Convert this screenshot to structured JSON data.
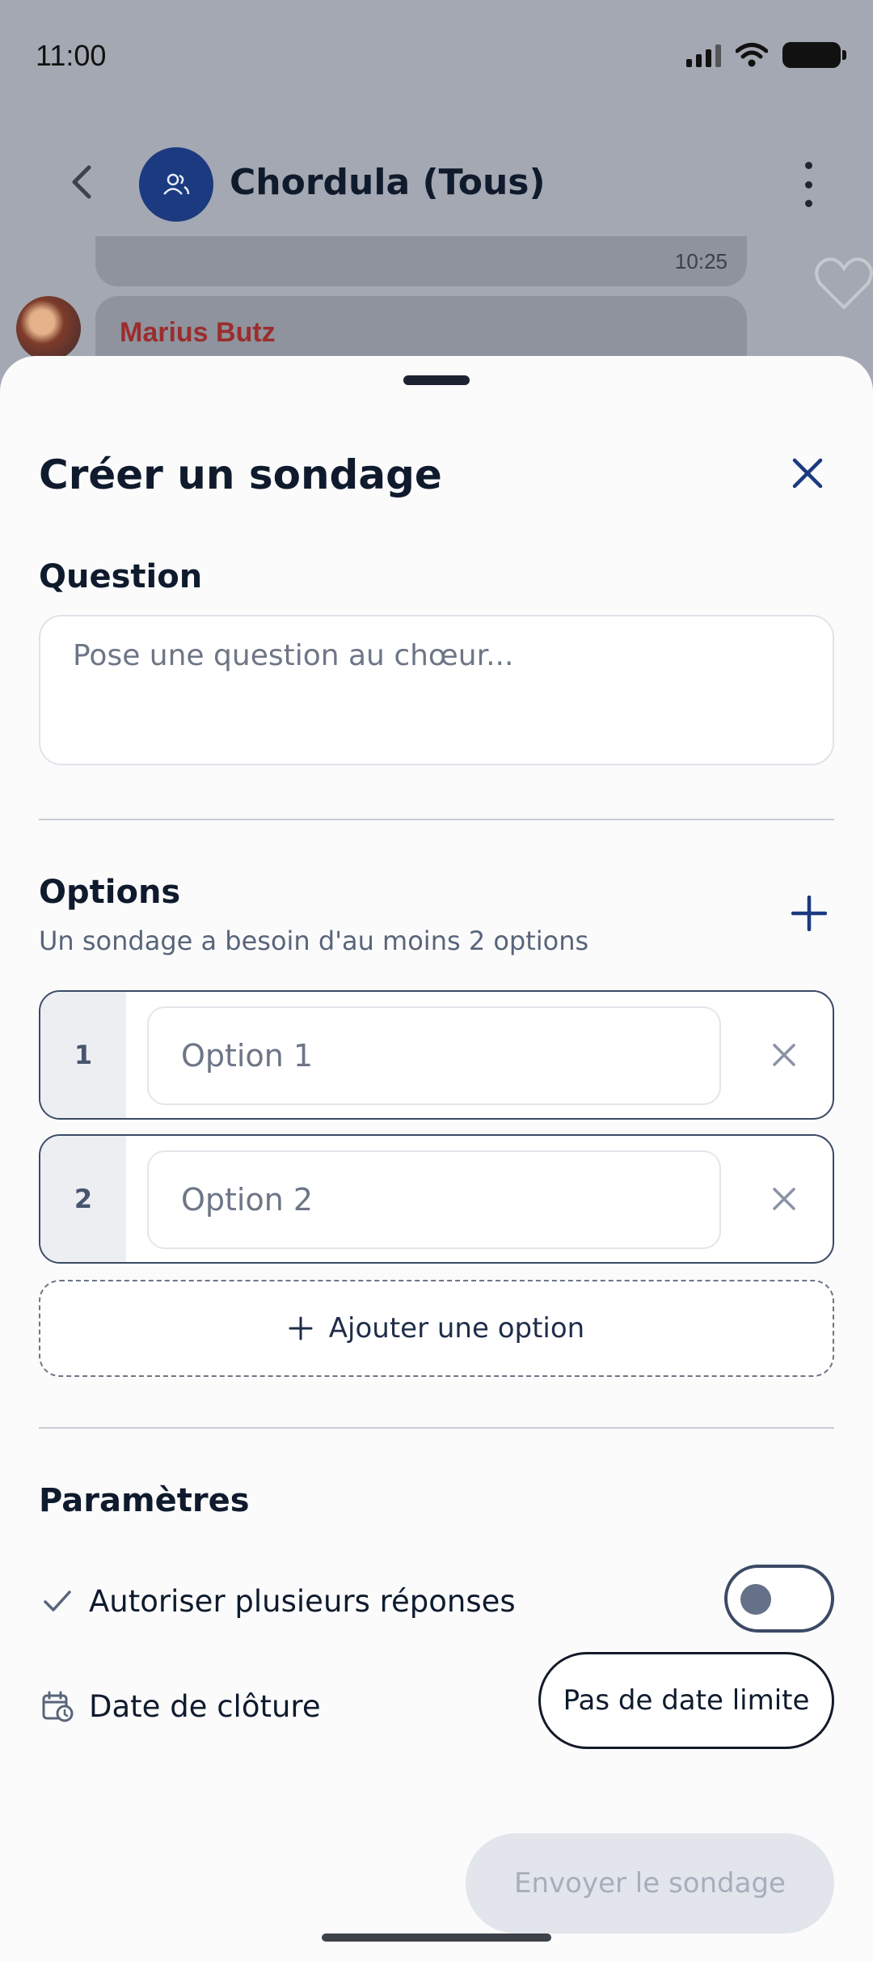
{
  "status_bar": {
    "time": "11:00"
  },
  "chat": {
    "title": "Chordula (Tous)",
    "message_time": "10:25",
    "sender_name": "Marius Butz"
  },
  "sheet": {
    "title": "Créer un sondage",
    "question": {
      "label": "Question",
      "placeholder": "Pose une question au chœur..."
    },
    "options": {
      "label": "Options",
      "hint": "Un sondage a besoin d'au moins 2 options",
      "items": [
        {
          "number": "1",
          "placeholder": "Option 1"
        },
        {
          "number": "2",
          "placeholder": "Option 2"
        }
      ],
      "add_label": "Ajouter une option"
    },
    "settings": {
      "label": "Paramètres",
      "multiple_answers_label": "Autoriser plusieurs réponses",
      "multiple_answers_enabled": false,
      "closing_date_label": "Date de clôture",
      "closing_date_value": "Pas de date limite"
    },
    "send_label": "Envoyer le sondage"
  },
  "colors": {
    "accent": "#1b3a80",
    "sender_name": "#9b2d2d",
    "disabled_button_bg": "#e2e5ec",
    "disabled_button_text": "#a7aebb"
  },
  "icons": {
    "back": "chevron-left-icon",
    "group": "group-icon",
    "more": "more-vertical-icon",
    "close": "close-icon",
    "add": "plus-icon",
    "remove": "x-icon",
    "check": "check-icon",
    "calendar": "calendar-clock-icon"
  }
}
